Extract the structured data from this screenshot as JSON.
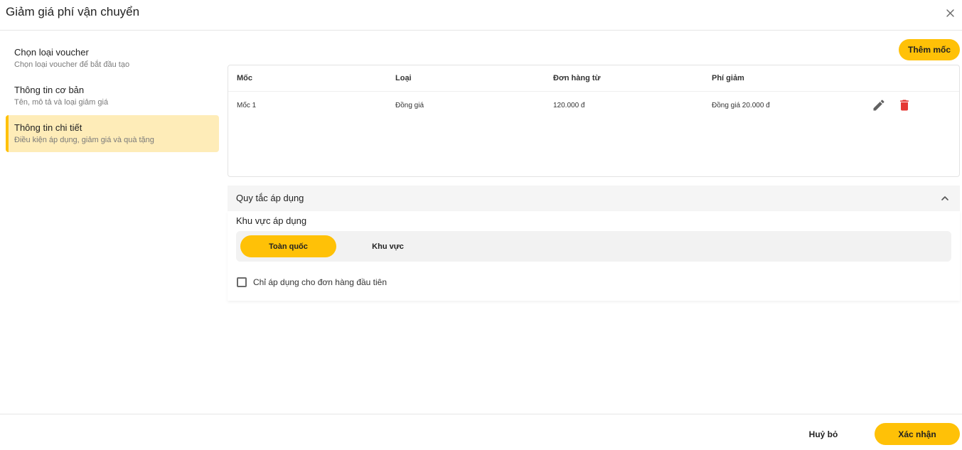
{
  "dialog": {
    "title": "Giảm giá phí vận chuyển",
    "close_icon": "close-icon"
  },
  "steps": [
    {
      "title": "Chọn loại voucher",
      "subtitle": "Chọn loại voucher để bắt đầu tạo",
      "active": false
    },
    {
      "title": "Thông tin cơ bản",
      "subtitle": "Tên, mô tả và loại giảm giá",
      "active": false
    },
    {
      "title": "Thông tin chi tiết",
      "subtitle": "Điều kiện áp dụng, giảm giá và quà tặng",
      "active": true
    }
  ],
  "milestones": {
    "add_label": "Thêm mốc",
    "columns": [
      "Mốc",
      "Loại",
      "Đơn hàng từ",
      "Phí giảm"
    ],
    "rows": [
      {
        "milestone": "Mốc 1",
        "type": "Đồng giá",
        "order_from": "120.000 đ",
        "discount": "Đồng giá 20.000 đ"
      }
    ],
    "edit_icon": "pencil-icon",
    "delete_icon": "trash-icon"
  },
  "rules": {
    "title": "Quy tắc áp dụng",
    "expanded": true,
    "area_label": "Khu vực áp dụng",
    "area_options": [
      "Toàn quốc",
      "Khu vực"
    ],
    "area_selected": "Toàn quốc",
    "first_order_label": "Chỉ áp dụng cho đơn hàng đầu tiên",
    "first_order_checked": false
  },
  "footer": {
    "cancel_label": "Huỷ bỏ",
    "confirm_label": "Xác nhận"
  },
  "colors": {
    "accent": "#ffc107",
    "active_step_bg": "#feecb8",
    "delete": "#e53935"
  }
}
